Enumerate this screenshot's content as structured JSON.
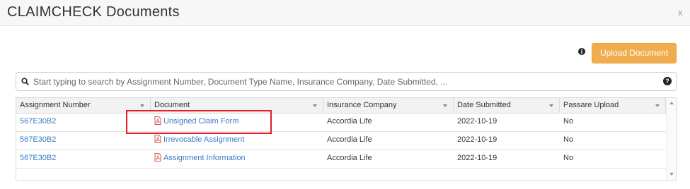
{
  "dialog": {
    "title": "CLAIMCHECK Documents",
    "close_label": "x"
  },
  "toolbar": {
    "info_icon": "info-icon",
    "upload_label": "Upload Document",
    "upload_color": "#f0ad4e"
  },
  "search": {
    "placeholder": "Start typing to search by Assignment Number, Document Type Name, Insurance Company, Date Submitted, ...",
    "value": "",
    "icon": "search-icon",
    "help_icon": "question-icon"
  },
  "table": {
    "columns": [
      "Assignment Number",
      "Document",
      "Insurance Company",
      "Date Submitted",
      "Passare Upload"
    ],
    "rows": [
      {
        "assignment": "567E30B2",
        "document": "Unsigned Claim Form",
        "company": "Accordia Life",
        "date": "2022-10-19",
        "passare": "No"
      },
      {
        "assignment": "567E30B2",
        "document": "Irrevocable Assignment",
        "company": "Accordia Life",
        "date": "2022-10-19",
        "passare": "No"
      },
      {
        "assignment": "567E30B2",
        "document": "Assignment Information",
        "company": "Accordia Life",
        "date": "2022-10-19",
        "passare": "No"
      }
    ],
    "link_color": "#3a7bc8",
    "pdf_icon_color": "#d9534f",
    "highlighted_row": 0,
    "highlight_color": "#e0202a"
  }
}
